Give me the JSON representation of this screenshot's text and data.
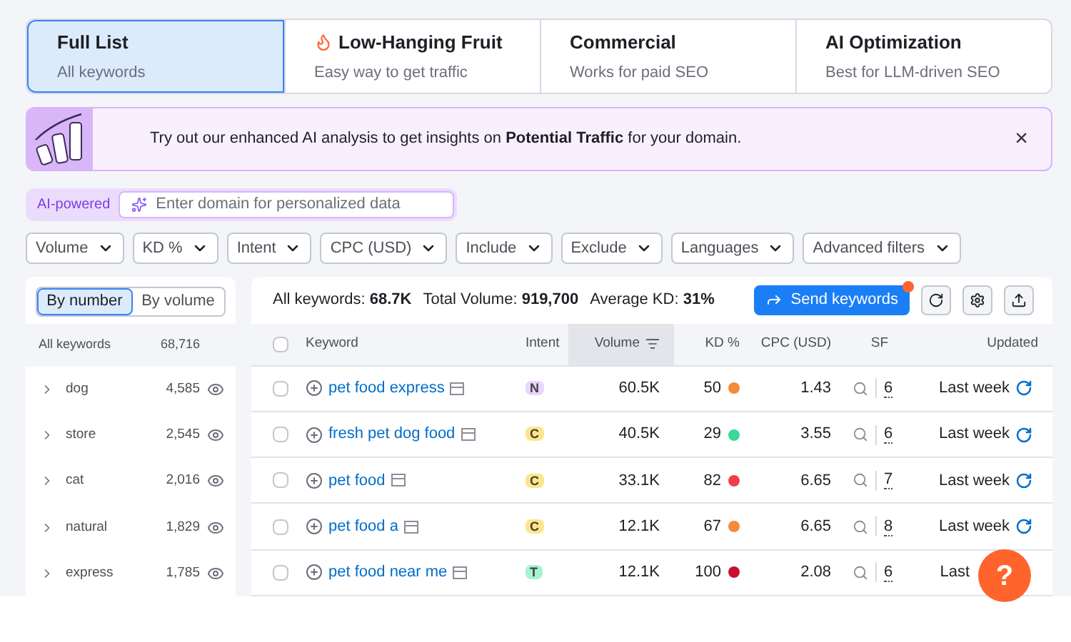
{
  "tabs": [
    {
      "title": "Full List",
      "subtitle": "All keywords",
      "selected": true,
      "kind": "plain"
    },
    {
      "title": "Low-Hanging Fruit",
      "subtitle": "Easy way to get traffic",
      "selected": false,
      "kind": "fire"
    },
    {
      "title": "Commercial",
      "subtitle": "Works for paid SEO",
      "selected": false,
      "kind": "plain"
    },
    {
      "title": "AI Optimization",
      "subtitle": "Best for LLM-driven SEO",
      "selected": false,
      "kind": "plain"
    }
  ],
  "banner": {
    "text": "Try out our enhanced AI analysis to get insights on **Potential Traffic** for your domain.",
    "close": "×"
  },
  "ai_field": {
    "badge": "AI-powered",
    "placeholder": "Enter domain for personalized data"
  },
  "filters": [
    "Volume",
    "KD %",
    "Intent",
    "CPC (USD)",
    "Include",
    "Exclude",
    "Languages",
    "Advanced filters"
  ],
  "group_toggle": [
    {
      "label": "By number",
      "selected": true
    },
    {
      "label": "By volume",
      "selected": false
    }
  ],
  "groups": {
    "header": {
      "label": "All keywords",
      "count": "68,716"
    },
    "items": [
      {
        "label": "dog",
        "count": "4,585"
      },
      {
        "label": "store",
        "count": "2,545"
      },
      {
        "label": "cat",
        "count": "2,016"
      },
      {
        "label": "natural",
        "count": "1,829"
      },
      {
        "label": "express",
        "count": "1,785"
      }
    ]
  },
  "summary": [
    {
      "label": "All keywords:",
      "value": "68.7K"
    },
    {
      "label": "Total Volume:",
      "value": "919,700"
    },
    {
      "label": "Average KD:",
      "value": "31%"
    }
  ],
  "send_button": {
    "label": "Send keywords",
    "notification": true
  },
  "table": {
    "select_all_checked": false,
    "columns": [
      {
        "label": "Keyword",
        "selected": false
      },
      {
        "label": "Intent",
        "selected": false
      },
      {
        "label": "Volume",
        "selected": true
      },
      {
        "label": "KD %",
        "selected": false
      },
      {
        "label": "CPC (USD)",
        "selected": false
      },
      {
        "label": "SF",
        "selected": false
      },
      {
        "label": "Updated",
        "selected": false
      }
    ],
    "rows": [
      {
        "checked": false,
        "keyword": "pet food express",
        "intent": {
          "label": "N",
          "color": "#e9d5ff"
        },
        "volume": "60.5K",
        "kd": {
          "value": "50",
          "color": "#f7893a"
        },
        "cpc": "1.43",
        "sf": "6",
        "updated": "Last week",
        "refresh": true
      },
      {
        "checked": false,
        "keyword": "fresh pet dog food",
        "intent": {
          "label": "C",
          "color": "#fde68a"
        },
        "volume": "40.5K",
        "kd": {
          "value": "29",
          "color": "#3dd598"
        },
        "cpc": "3.55",
        "sf": "6",
        "updated": "Last week",
        "refresh": true
      },
      {
        "checked": false,
        "keyword": "pet food",
        "intent": {
          "label": "C",
          "color": "#fde68a"
        },
        "volume": "33.1K",
        "kd": {
          "value": "82",
          "color": "#f03e4c"
        },
        "cpc": "6.65",
        "sf": "7",
        "updated": "Last week",
        "refresh": true
      },
      {
        "checked": false,
        "keyword": "pet food a",
        "intent": {
          "label": "C",
          "color": "#fde68a"
        },
        "volume": "12.1K",
        "kd": {
          "value": "67",
          "color": "#f7893a"
        },
        "cpc": "6.65",
        "sf": "8",
        "updated": "Last week",
        "refresh": true
      },
      {
        "checked": false,
        "keyword": "pet food near me",
        "intent": {
          "label": "T",
          "color": "#a7f3d0"
        },
        "volume": "12.1K",
        "kd": {
          "value": "100",
          "color": "#c8102e"
        },
        "cpc": "2.08",
        "sf": "6",
        "updated": "Last",
        "refresh": false
      }
    ]
  },
  "help_button": "?"
}
